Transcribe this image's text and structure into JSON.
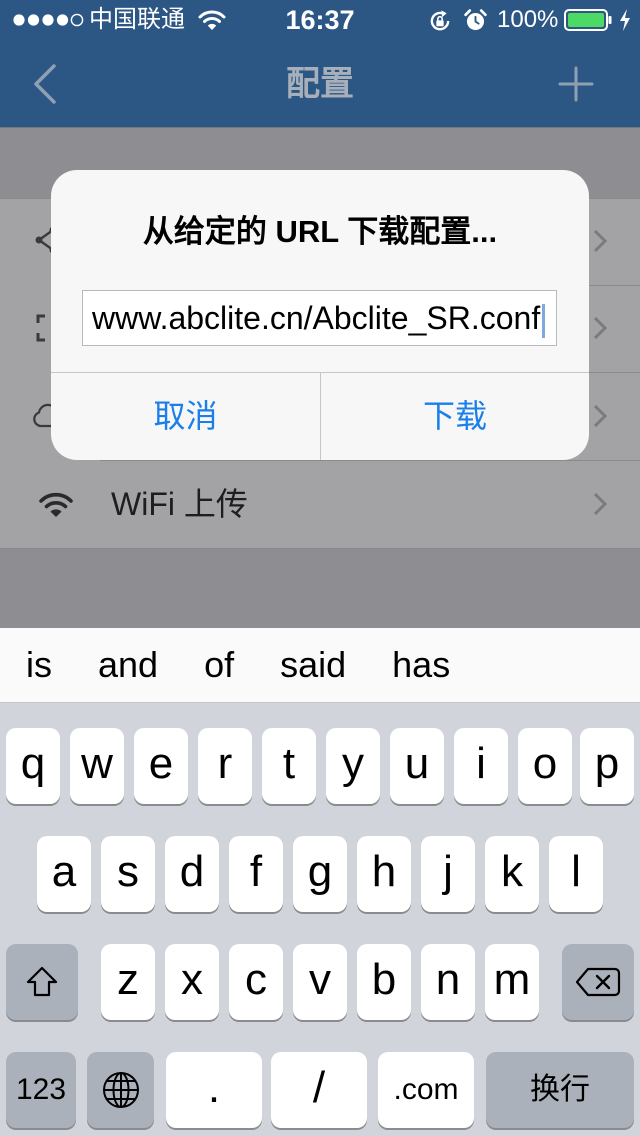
{
  "status_bar": {
    "carrier": "中国联通",
    "time": "16:37",
    "battery_text": "100%",
    "battery_level": 1.0,
    "signal_strength": 4,
    "signal_max": 5,
    "icons": [
      "signal-dots-icon",
      "wifi-icon",
      "rotation-lock-icon",
      "alarm-icon",
      "battery-icon",
      "charging-bolt-icon"
    ]
  },
  "nav": {
    "title": "配置",
    "back_icon": "chevron-left-icon",
    "add_icon": "plus-icon"
  },
  "list": {
    "rows": [
      {
        "icon": "share-icon",
        "accessory": "chevron-right-icon"
      },
      {
        "icon": "scan-icon",
        "accessory": "chevron-right-icon"
      },
      {
        "icon": "cloud-icon",
        "accessory": "chevron-right-icon"
      },
      {
        "icon": "wifi-icon",
        "label": "WiFi 上传",
        "accessory": "chevron-right-icon"
      }
    ]
  },
  "dialog": {
    "title": "从给定的 URL 下载配置...",
    "input_value": "www.abclite.cn/Abclite_SR.conf",
    "cancel_label": "取消",
    "confirm_label": "下载"
  },
  "suggestions": [
    "is",
    "and",
    "of",
    "said",
    "has"
  ],
  "keyboard": {
    "row1": [
      "q",
      "w",
      "e",
      "r",
      "t",
      "y",
      "u",
      "i",
      "o",
      "p"
    ],
    "row2": [
      "a",
      "s",
      "d",
      "f",
      "g",
      "h",
      "j",
      "k",
      "l"
    ],
    "row3": [
      "z",
      "x",
      "c",
      "v",
      "b",
      "n",
      "m"
    ],
    "bottom": {
      "numbers_label": "123",
      "period_label": ".",
      "slash_label": "/",
      "dotcom_label": ".com",
      "return_label": "换行"
    },
    "icons": {
      "shift": "shift-icon",
      "globe": "globe-icon",
      "delete": "delete-icon"
    }
  },
  "colors": {
    "nav_bar": "#2c5784",
    "accent": "#1a7fe8",
    "battery": "#4cd964",
    "keyboard": "#d1d4da",
    "special_key": "#abb1ba"
  }
}
